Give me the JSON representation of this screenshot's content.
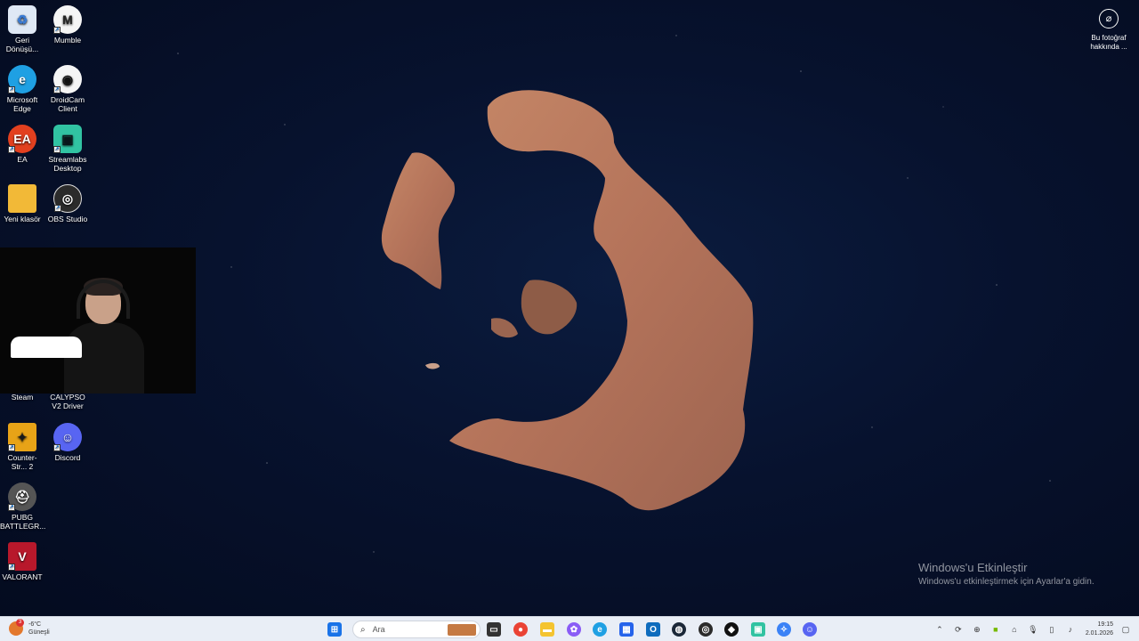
{
  "desktop": {
    "icons": [
      {
        "label": "Geri Dönüşü...",
        "icon": "recycle-bin-icon",
        "color": "#ffffff"
      },
      {
        "label": "Mumble",
        "icon": "mumble-icon",
        "color": "#ffffff"
      },
      {
        "label": "Microsoft Edge",
        "icon": "edge-icon",
        "color": "#1fa0e3"
      },
      {
        "label": "DroidCam Client",
        "icon": "droidcam-icon",
        "color": "#ffffff"
      },
      {
        "label": "EA",
        "icon": "ea-icon",
        "color": "#e2401f"
      },
      {
        "label": "Streamlabs Desktop",
        "icon": "streamlabs-icon",
        "color": "#31c3a2"
      },
      {
        "label": "Yeni klasör",
        "icon": "folder-icon",
        "color": "#f2b937"
      },
      {
        "label": "OBS Studio",
        "icon": "obs-icon",
        "color": "#2b2b2b"
      },
      {
        "label": "Steam",
        "icon": "steam-icon",
        "color": "#1b2838"
      },
      {
        "label": "CALYPSO V2 Driver",
        "icon": "calypso-icon",
        "color": "#222222"
      },
      {
        "label": "Counter-Str... 2",
        "icon": "counter-strike-icon",
        "color": "#e8a317"
      },
      {
        "label": "Discord",
        "icon": "discord-icon",
        "color": "#5865f2"
      },
      {
        "label": "PUBG BATTLEGR...",
        "icon": "pubg-icon",
        "color": "#555555"
      },
      {
        "label": "VALORANT",
        "icon": "valorant-icon",
        "color": "#b8182b"
      }
    ]
  },
  "photo_info": {
    "label": "Bu fotoğraf hakkında ..."
  },
  "watermark": {
    "title": "Windows'u Etkinleştir",
    "subtitle": "Windows'u etkinleştirmek için Ayarlar'a gidin."
  },
  "taskbar": {
    "weather": {
      "temp": "-6°C",
      "condition": "Güneşli",
      "badge": "3"
    },
    "search_placeholder": "Ara",
    "apps": [
      {
        "icon": "start-icon",
        "color": "#1a73e8"
      },
      {
        "icon": "task-view-icon",
        "color": "#333333"
      },
      {
        "icon": "chrome-icon",
        "color": "#ea4335"
      },
      {
        "icon": "file-explorer-icon",
        "color": "#f4c430"
      },
      {
        "icon": "copilot-icon",
        "color": "#8a5cf6"
      },
      {
        "icon": "edge-taskbar-icon",
        "color": "#1fa0e3"
      },
      {
        "icon": "store-icon",
        "color": "#2563eb"
      },
      {
        "icon": "outlook-icon",
        "color": "#0f6cbd"
      },
      {
        "icon": "steam-taskbar-icon",
        "color": "#1b2838"
      },
      {
        "icon": "obs-taskbar-icon",
        "color": "#2b2b2b"
      },
      {
        "icon": "riot-icon",
        "color": "#111111"
      },
      {
        "icon": "streamlabs-taskbar-icon",
        "color": "#31c3a2"
      },
      {
        "icon": "app-blue-icon",
        "color": "#3b82f6"
      },
      {
        "icon": "discord-taskbar-icon",
        "color": "#5865f2"
      }
    ],
    "clock": {
      "time": "19:15",
      "date": "2.01.2026"
    }
  }
}
